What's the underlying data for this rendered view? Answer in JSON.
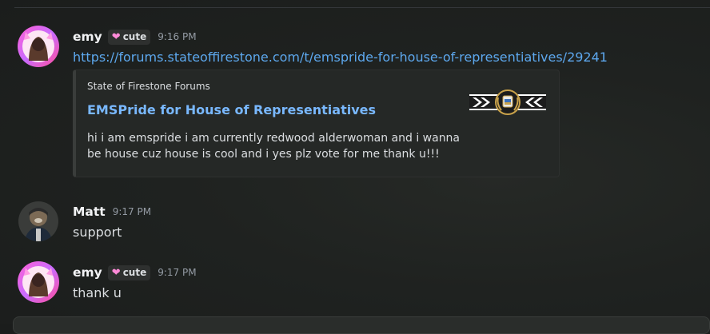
{
  "messages": [
    {
      "author": "emy",
      "role_tag": "cute",
      "timestamp": "9:16 PM",
      "link": "https://forums.stateoffirestone.com/t/emspride-for-house-of-representiatives/29241",
      "embed": {
        "provider": "State of Firestone Forums",
        "title": "EMSPride for House of Representiatives",
        "description": "hi i am emspride i am currently redwood alderwoman and i wanna be house cuz house is cool and i yes plz vote for me thank u!!!"
      }
    },
    {
      "author": "Matt",
      "timestamp": "9:17 PM",
      "text": "support"
    },
    {
      "author": "emy",
      "role_tag": "cute",
      "timestamp": "9:17 PM",
      "text": "thank u"
    }
  ],
  "icons": {
    "role_heart": "heart-icon"
  },
  "colors": {
    "link": "#5da8ee",
    "embed_title": "#79b8ff",
    "role_heart": "#ff8ad8",
    "background": "#1f2220"
  }
}
